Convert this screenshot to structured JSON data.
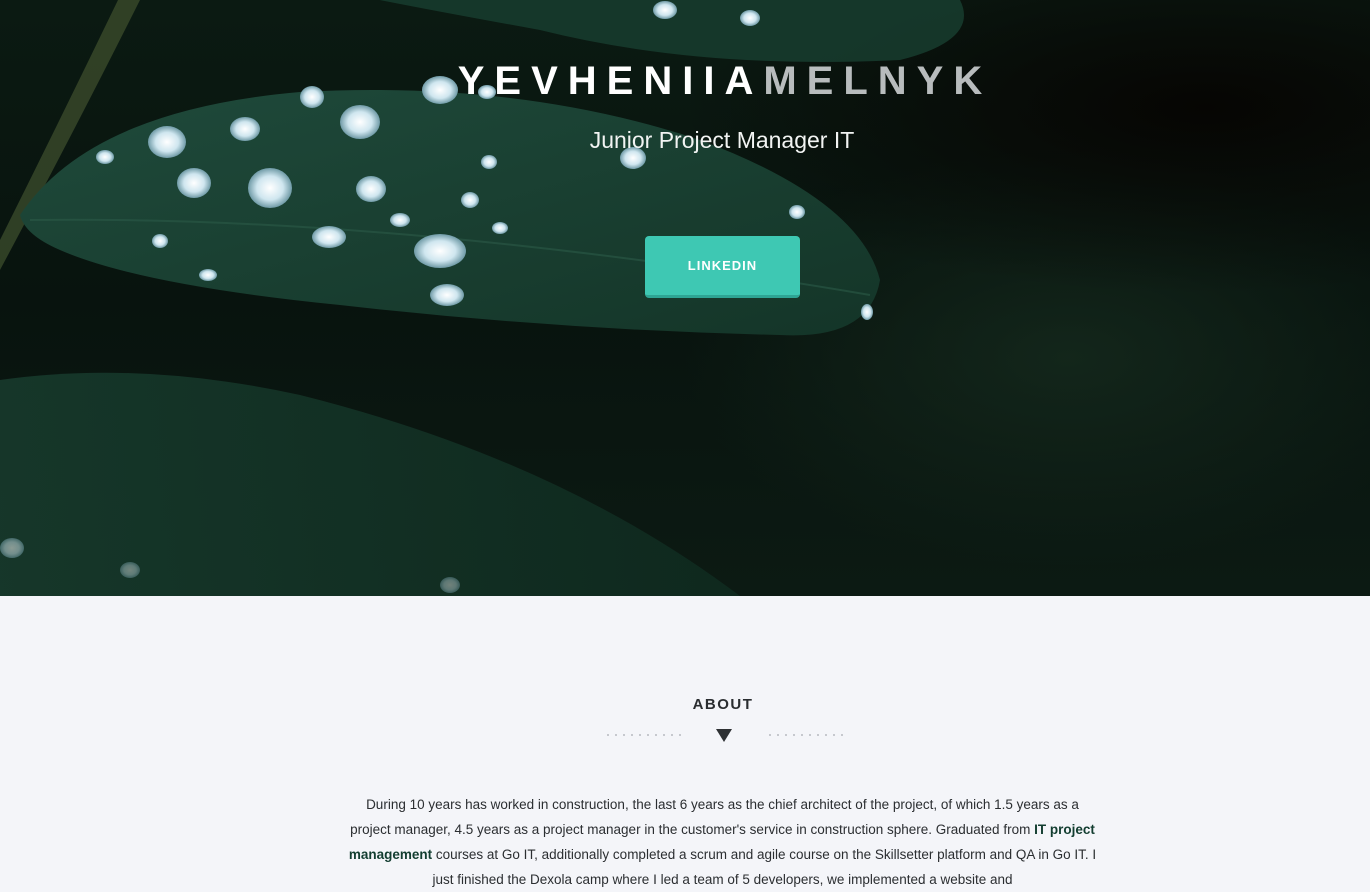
{
  "hero": {
    "first_name": "YEVHENIIA",
    "last_name": "MELNYK",
    "subtitle": "Junior Project Manager IT",
    "linkedin_label": "LINKEDIN"
  },
  "about": {
    "title": "ABOUT",
    "text_part1": "During 10 years has worked in construction, the last 6 years as the chief architect of the project, of which 1.5 years as a project manager, 4.5 years as a project manager in the customer's service in construction sphere. Graduated from ",
    "highlight": "IT project management",
    "text_part2": " courses at Go IT, additionally completed a scrum and agile course on the Skillsetter platform and QA in Go IT. I just finished the Dexola camp where I led a team of 5 developers, we implemented a website and"
  },
  "colors": {
    "accent": "#3ec8b3",
    "highlight": "#123d30",
    "background": "#f4f5f9"
  }
}
